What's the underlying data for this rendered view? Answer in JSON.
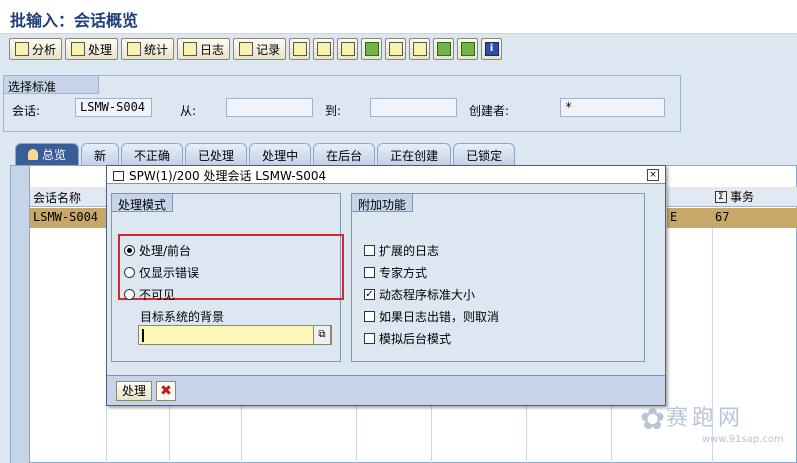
{
  "title": "批输入：会话概览",
  "toolbar": {
    "analyze": "分析",
    "process": "处理",
    "stats": "统计",
    "log": "日志",
    "record": "记录"
  },
  "criteria": {
    "header": "选择标准",
    "session_label": "会话:",
    "session_value": "LSMW-S004",
    "from_label": "从:",
    "from_value": "",
    "to_label": "到:",
    "to_value": "",
    "creator_label": "创建者:",
    "creator_value": "*"
  },
  "tabs": [
    "总览",
    "新",
    "不正确",
    "已处理",
    "处理中",
    "在后台",
    "正在创建",
    "已锁定"
  ],
  "grid": {
    "col_name": "会话名称",
    "col_tx": "事务",
    "row_name": "LSMW-S004",
    "row_partial": "E",
    "row_tx": "67"
  },
  "dialog": {
    "title": "SPW(1)/200 处理会话 LSMW-S004",
    "mode_header": "处理模式",
    "modes": [
      "处理/前台",
      "仅显示错误",
      "不可见"
    ],
    "mode_selected": 0,
    "bg_label": "目标系统的背景",
    "extra_header": "附加功能",
    "extras": [
      "扩展的日志",
      "专家方式",
      "动态程序标准大小",
      "如果日志出错，则取消",
      "模拟后台模式"
    ],
    "extras_checked": [
      false,
      false,
      true,
      false,
      false
    ],
    "ok_button": "处理"
  },
  "watermark": {
    "main": "赛跑网",
    "sub": "www.91sap.com"
  }
}
